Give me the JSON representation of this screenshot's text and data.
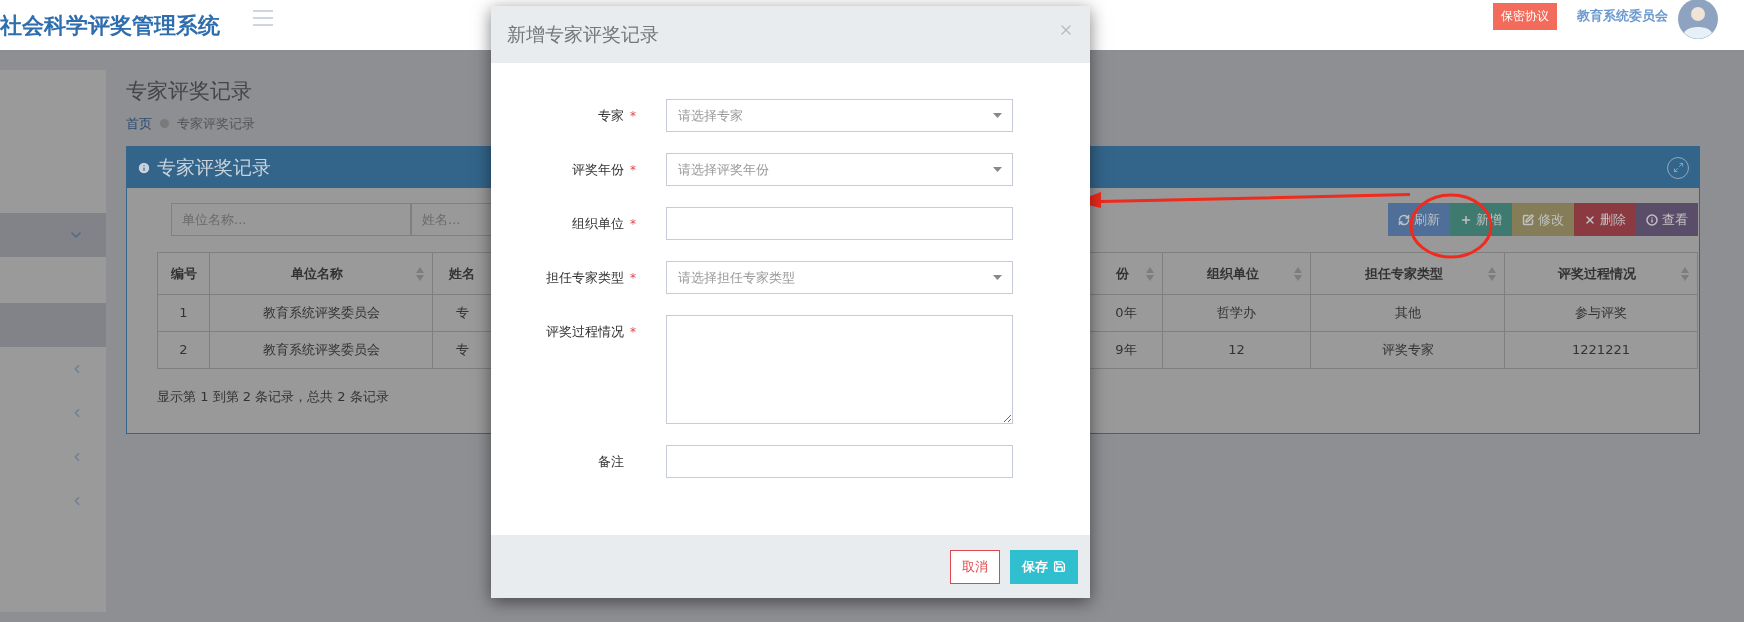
{
  "header": {
    "title": "社会科学评奖管理系统",
    "agreement_button": "保密协议",
    "user_name": "教育系统委员会"
  },
  "sidebar": {
    "items": [
      {
        "kind": "group",
        "expanded": true
      },
      {
        "kind": "link",
        "selected": true
      },
      {
        "kind": "group",
        "expanded": false
      },
      {
        "kind": "group",
        "expanded": false
      },
      {
        "kind": "group",
        "expanded": false
      },
      {
        "kind": "group",
        "expanded": false
      }
    ]
  },
  "page_title": "专家评奖记录",
  "breadcrumb": [
    {
      "kind": "link",
      "text": "首页"
    },
    {
      "kind": "current",
      "text": "专家评奖记录"
    }
  ],
  "panel": {
    "title": "专家评奖记录",
    "search": [
      {
        "placeholder": "单位名称..."
      },
      {
        "placeholder": "姓名..."
      }
    ],
    "toolbar": [
      {
        "kind": "refresh",
        "label": "刷新"
      },
      {
        "kind": "add",
        "label": "新增"
      },
      {
        "kind": "edit",
        "label": "修改"
      },
      {
        "kind": "delete",
        "label": "删除"
      },
      {
        "kind": "view",
        "label": "查看"
      }
    ],
    "table": {
      "columns": [
        {
          "label": "编号",
          "sortable": false
        },
        {
          "label": "单位名称",
          "sortable": true
        },
        {
          "label": "姓名",
          "sortable": false
        },
        {
          "label": "份",
          "sortable": true
        },
        {
          "label": "组织单位",
          "sortable": true
        },
        {
          "label": "担任专家类型",
          "sortable": true
        },
        {
          "label": "评奖过程情况",
          "sortable": true
        }
      ],
      "rows": [
        [
          "1",
          "教育系统评奖委员会",
          "专",
          "0年",
          "哲学办",
          "其他",
          "参与评奖"
        ],
        [
          "2",
          "教育系统评奖委员会",
          "专",
          "9年",
          "12",
          "评奖专家",
          "1221221"
        ]
      ]
    },
    "footer": "显示第 1 到第 2 条记录，总共 2 条记录"
  },
  "modal": {
    "title": "新增专家评奖记录",
    "fields": [
      {
        "kind": "select",
        "label": "专家",
        "required_mark": "*",
        "placeholder": "请选择专家"
      },
      {
        "kind": "select",
        "label": "评奖年份",
        "required_mark": "*",
        "placeholder": "请选择评奖年份"
      },
      {
        "kind": "text",
        "label": "组织单位",
        "required_mark": "*"
      },
      {
        "kind": "select",
        "label": "担任专家类型",
        "required_mark": "*",
        "placeholder": "请选择担任专家类型"
      },
      {
        "kind": "textarea",
        "label": "评奖过程情况",
        "required_mark": "*"
      },
      {
        "kind": "text",
        "label": "备注"
      }
    ],
    "cancel_button": "取消",
    "save_button": "保存"
  }
}
